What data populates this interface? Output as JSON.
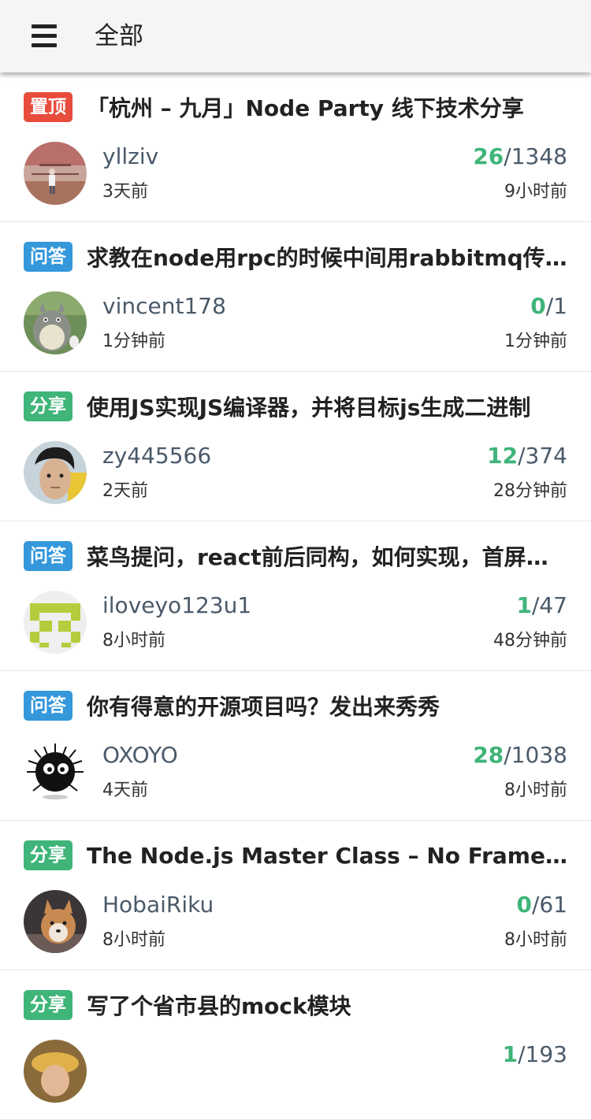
{
  "header": {
    "title": "全部"
  },
  "colors": {
    "tag_top": "#e74c3c",
    "tag_ask": "#3498db",
    "tag_share": "#3fb579",
    "reply_green": "#3fb579"
  },
  "topics": [
    {
      "tag": "置顶",
      "tag_type": "top",
      "title": "「杭州 – 九月」Node Party 线下技术分享",
      "author": "yllziv",
      "created": "3天前",
      "replies": "26",
      "visits": "/1348",
      "last_reply": "9小时前"
    },
    {
      "tag": "问答",
      "tag_type": "ask",
      "title": "求教在node用rpc的时候中间用rabbitmq传递数据的问题",
      "author": "vincent178",
      "created": "1分钟前",
      "replies": "0",
      "visits": "/1",
      "last_reply": "1分钟前"
    },
    {
      "tag": "分享",
      "tag_type": "share",
      "title": "使用JS实现JS编译器，并将目标js生成二进制",
      "author": "zy445566",
      "created": "2天前",
      "replies": "12",
      "visits": "/374",
      "last_reply": "28分钟前"
    },
    {
      "tag": "问答",
      "tag_type": "ask",
      "title": "菜鸟提问，react前后同构，如何实现，首屏渲染的问题",
      "author": "iloveyo123u1",
      "created": "8小时前",
      "replies": "1",
      "visits": "/47",
      "last_reply": "48分钟前"
    },
    {
      "tag": "问答",
      "tag_type": "ask",
      "title": "你有得意的开源项目吗？发出来秀秀",
      "author": "OXOYO",
      "created": "4天前",
      "replies": "28",
      "visits": "/1038",
      "last_reply": "8小时前"
    },
    {
      "tag": "分享",
      "tag_type": "share",
      "title": "The Node.js Master Class – No Frameworks, No NPM",
      "author": "HobaiRiku",
      "created": "8小时前",
      "replies": "0",
      "visits": "/61",
      "last_reply": "8小时前"
    },
    {
      "tag": "分享",
      "tag_type": "share",
      "title": "写了个省市县的mock模块",
      "author": "",
      "created": "",
      "replies": "1",
      "visits": "/193",
      "last_reply": ""
    }
  ]
}
